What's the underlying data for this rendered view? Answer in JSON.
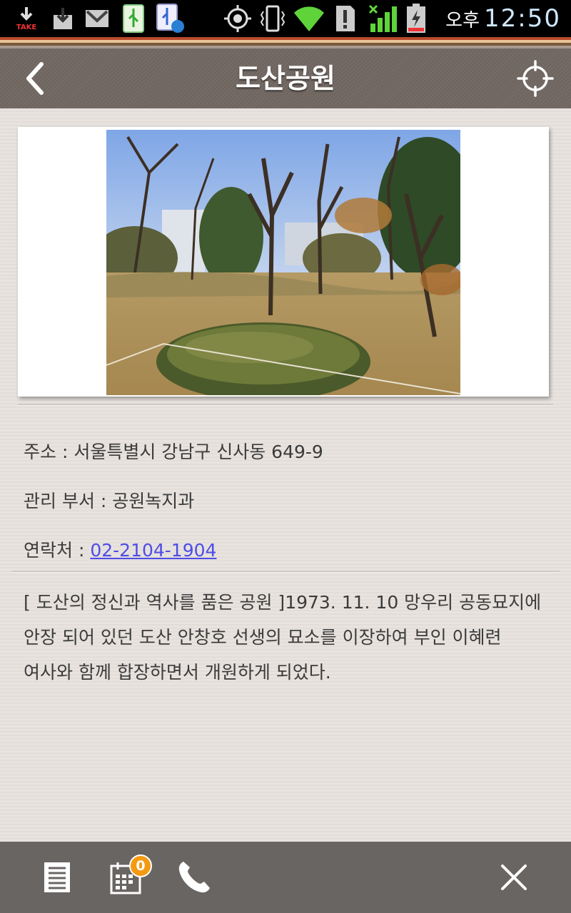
{
  "status_bar": {
    "take_label": "TAKE",
    "ampm": "오후",
    "time": "12:50",
    "icons": [
      "download-take-icon",
      "download-icon",
      "gmail-icon",
      "usb-icon",
      "usb-debug-icon",
      "gps-icon",
      "vibrate-icon",
      "wifi-icon",
      "alert-icon",
      "signal-icon",
      "battery-charging-icon"
    ]
  },
  "header": {
    "title": "도산공원",
    "back_icon": "chevron-left-icon",
    "locate_icon": "crosshair-icon"
  },
  "park": {
    "photo_alt": "park-photo",
    "address_label": "주소 : ",
    "address_value": "서울특별시 강남구 신사동 649-9",
    "department_label": "관리 부서 : ",
    "department_value": "공원녹지과",
    "contact_label": "연락처 : ",
    "contact_value": "02-2104-1904",
    "description_lines": [
      " [ 도산의 정신과 역사를 품은 공원 ]1973. 11. 10 망우리 공동묘지에",
      "안장 되어 있던 도산 안창호 선생의 묘소를 이장하여 부인 이혜련",
      "여사와 함께 합장하면서 개원하게 되었다."
    ]
  },
  "bottom_bar": {
    "calendar_badge": "0",
    "icons": [
      "document-list-icon",
      "calendar-icon",
      "phone-icon",
      "close-icon"
    ]
  },
  "colors": {
    "link": "#4d4de6",
    "header_bg": "#736964",
    "bottom_bar_bg": "#696563",
    "badge": "#f39a11"
  }
}
